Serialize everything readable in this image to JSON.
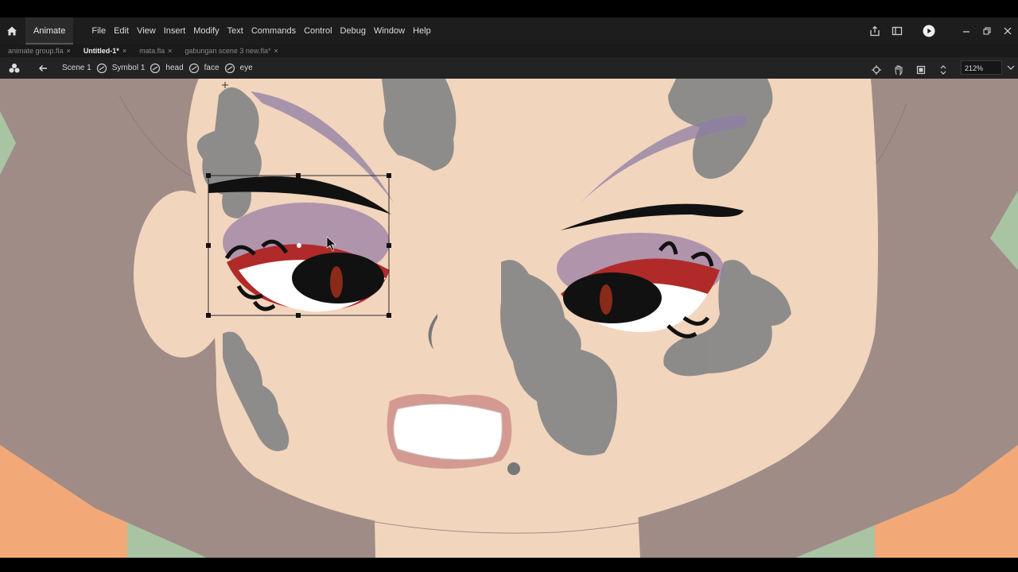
{
  "app": {
    "name": "Animate"
  },
  "menu": [
    "File",
    "Edit",
    "View",
    "Insert",
    "Modify",
    "Text",
    "Commands",
    "Control",
    "Debug",
    "Window",
    "Help"
  ],
  "tabs": [
    {
      "label": "animate group.fla",
      "close": "×"
    },
    {
      "label": "Untitled-1*",
      "close": "×"
    },
    {
      "label": "mata.fla",
      "close": "×"
    },
    {
      "label": "gabungan scene 3 new.fla*",
      "close": "×"
    }
  ],
  "breadcrumb": [
    "Scene 1",
    "Symbol 1",
    "head",
    "face",
    "eye"
  ],
  "zoom": "212%",
  "colors": {
    "skin": "#f2d5bd",
    "hair": "#a08c87",
    "shadow_marks": "#888888",
    "iris_red": "#b02a2a",
    "eyeshadow": "#9a7ea6",
    "background_green": "#a8c4a3",
    "shirt_orange": "#f3a977",
    "selection": "#000000"
  }
}
